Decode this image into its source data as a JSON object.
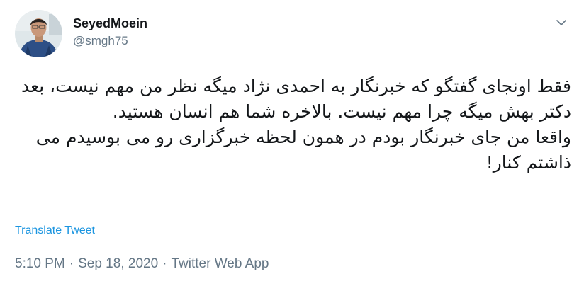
{
  "tweet": {
    "author": {
      "display_name": "SeyedMoein",
      "handle": "@smgh75"
    },
    "text": "فقط اونجای گفتگو که خبرنگار به احمدی نژاد میگه نظر من مهم نیست، بعد دکتر بهش میگه چرا مهم نیست. بالاخره شما هم انسان هستید.\nواقعا من جای خبرنگار بودم در همون لحظه خبرگزاری رو می بوسیدم می ذاشتم کنار!",
    "translate_label": "Translate Tweet",
    "time": "5:10 PM",
    "separator": "·",
    "date": "Sep 18, 2020",
    "source": "Twitter Web App"
  },
  "colors": {
    "text": "#14171a",
    "secondary": "#657786",
    "link": "#1b95e0"
  },
  "icons": {
    "menu": "chevron-down-icon",
    "avatar": "avatar"
  }
}
